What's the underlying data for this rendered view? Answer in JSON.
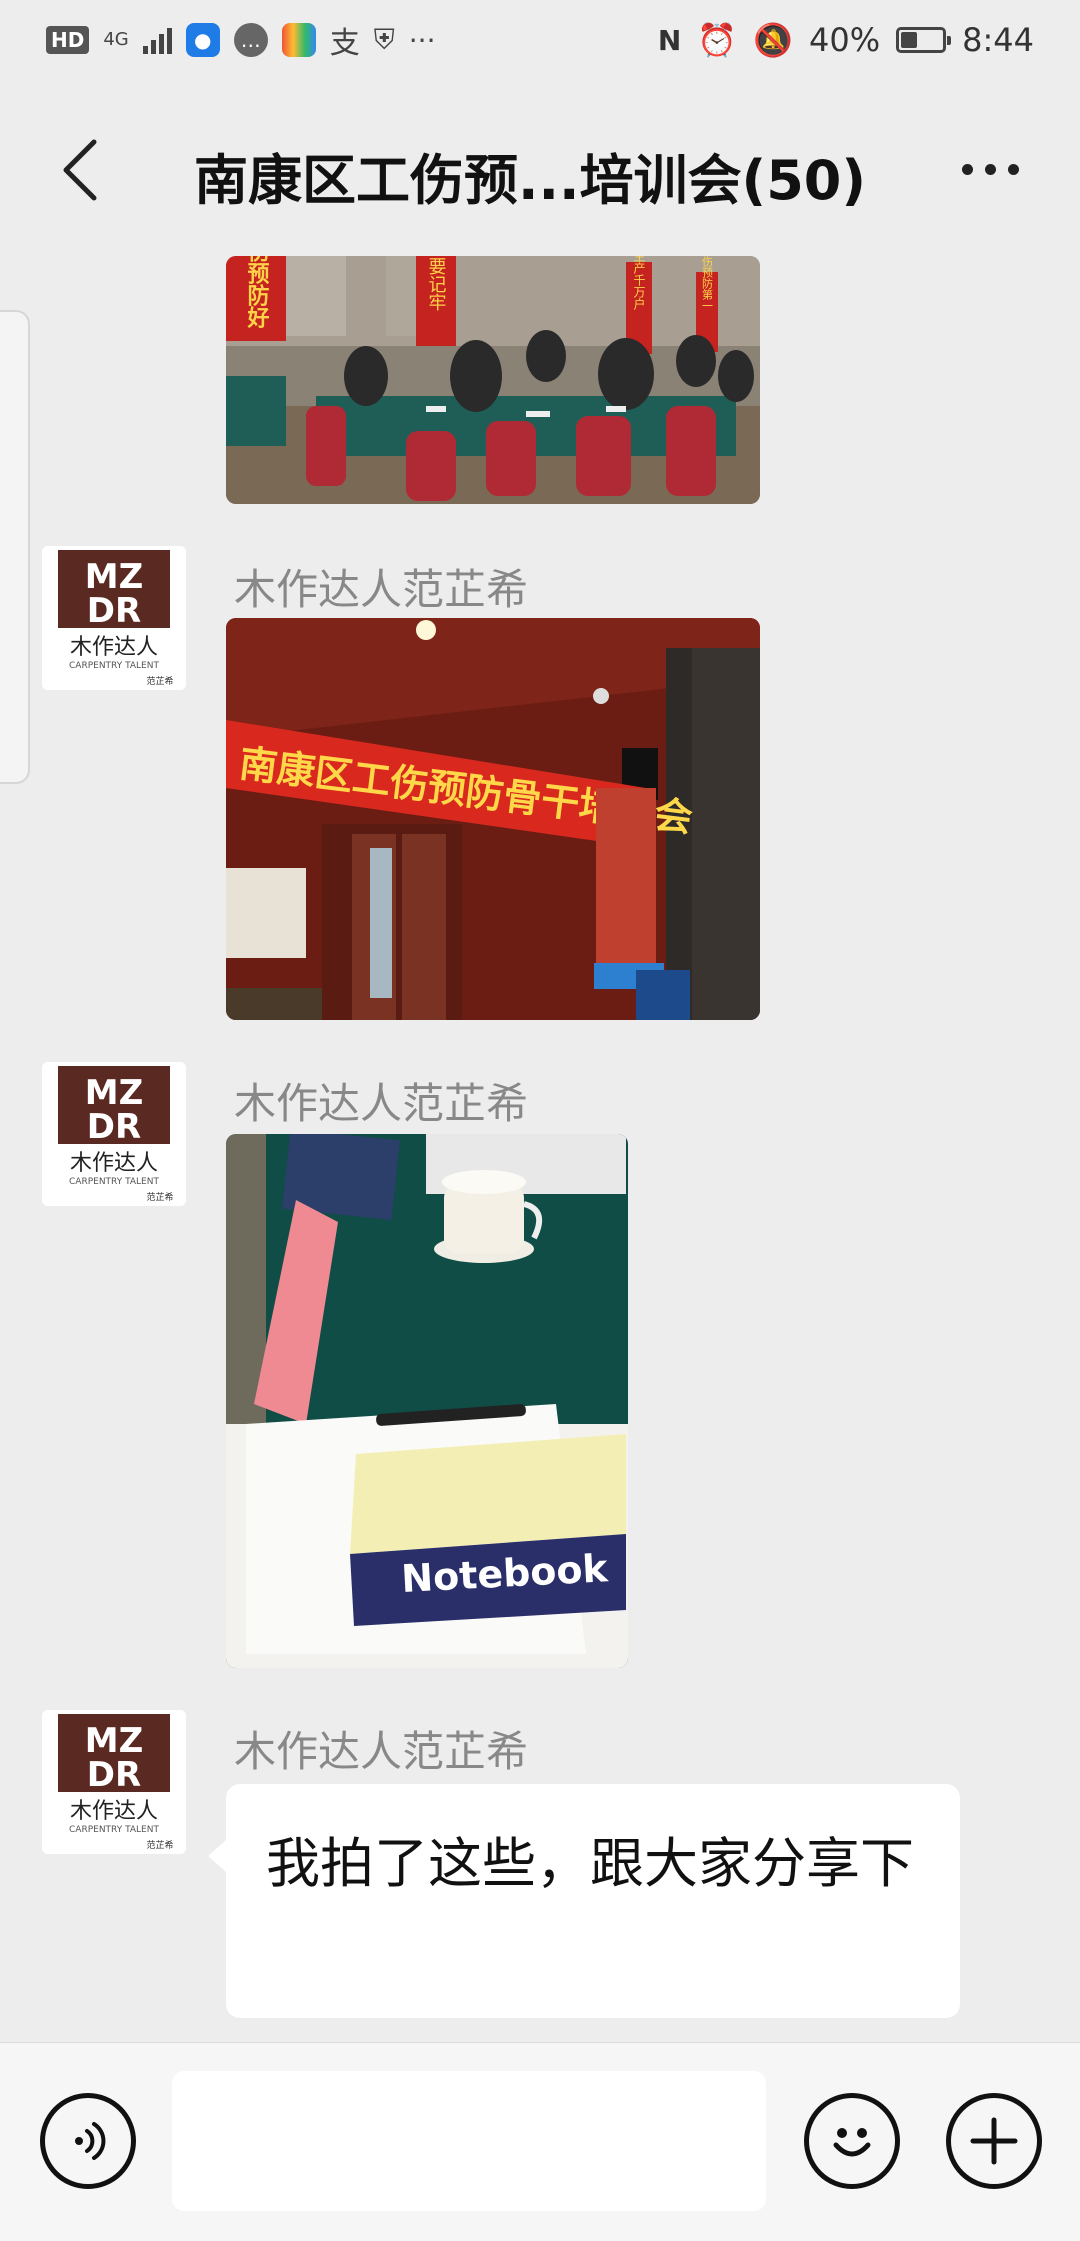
{
  "status_bar": {
    "left_items": [
      "HD",
      "4G"
    ],
    "battery": "40%",
    "battery_level": 0.4,
    "time": "8:44",
    "icons": [
      "hd-icon",
      "signal-icon",
      "app-icon-blue",
      "message-icon",
      "live-app-icon",
      "alipay-icon",
      "shield-icon",
      "more-dots-icon",
      "nfc-icon",
      "alarm-icon",
      "mute-bell-icon",
      "battery-icon"
    ]
  },
  "header": {
    "title": "南康区工伤预...培训会(50)"
  },
  "messages": [
    {
      "type": "image",
      "banners": [
        "伤预防好",
        "人人要记牢",
        "安全生产千万户",
        "工伤预防第一"
      ]
    },
    {
      "type": "image",
      "sender": "木作达人范芷希",
      "banner_text": "南康区工伤预防骨干培训会"
    },
    {
      "type": "image",
      "sender": "木作达人范芷希",
      "notebook_label": "Notebook"
    },
    {
      "type": "text",
      "sender": "木作达人范芷希",
      "text": "我拍了这些，跟大家分享下"
    }
  ],
  "avatar": {
    "logo_top": "MZ",
    "logo_bottom": "DR",
    "name_cn": "木作达人",
    "name_en": "CARPENTRY TALENT",
    "signature": "范芷希",
    "brand_color": "#5a2a22"
  },
  "input_bar": {
    "value": "",
    "icons": [
      "voice-icon",
      "emoji-icon",
      "plus-icon"
    ]
  }
}
